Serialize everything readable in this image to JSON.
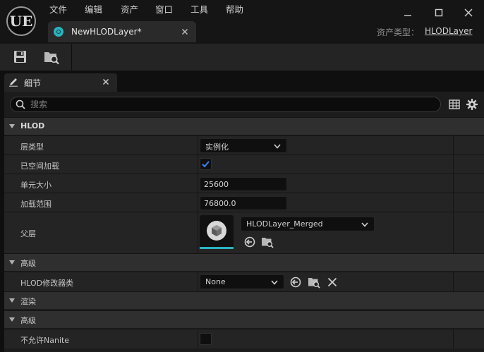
{
  "app": {
    "logo": "UE",
    "menu": [
      "文件",
      "编辑",
      "资产",
      "窗口",
      "工具",
      "帮助"
    ],
    "document_tab": "NewHLODLayer*",
    "asset_type_label": "资产类型：",
    "asset_type_value": "HLODLayer"
  },
  "toolbar": {
    "buttons": [
      {
        "icon": "save-icon"
      },
      {
        "icon": "browse-to-asset-icon"
      }
    ]
  },
  "details": {
    "tab_label": "细节",
    "search_placeholder": "搜索",
    "categories": {
      "hlod": "HLOD",
      "advanced_1": "高级",
      "rendering": "渲染",
      "advanced_2": "高级"
    },
    "properties": {
      "layer_type": {
        "label": "层类型",
        "value": "实例化"
      },
      "spatially_loaded": {
        "label": "已空间加载",
        "checked": true
      },
      "cell_size": {
        "label": "单元大小",
        "value": "25600"
      },
      "loading_range": {
        "label": "加载范围",
        "value": "76800.0"
      },
      "parent_layer": {
        "label": "父层",
        "value": "HLODLayer_Merged"
      },
      "hlod_modifier_class": {
        "label": "HLOD修改器类",
        "value": "None"
      },
      "disallow_nanite": {
        "label": "不允许Nanite",
        "checked": false
      }
    }
  },
  "colors": {
    "accent": "#2ab3c1",
    "checkbox_blue": "#2f86ff",
    "panel": "#242424",
    "category": "#2f2f2f"
  }
}
